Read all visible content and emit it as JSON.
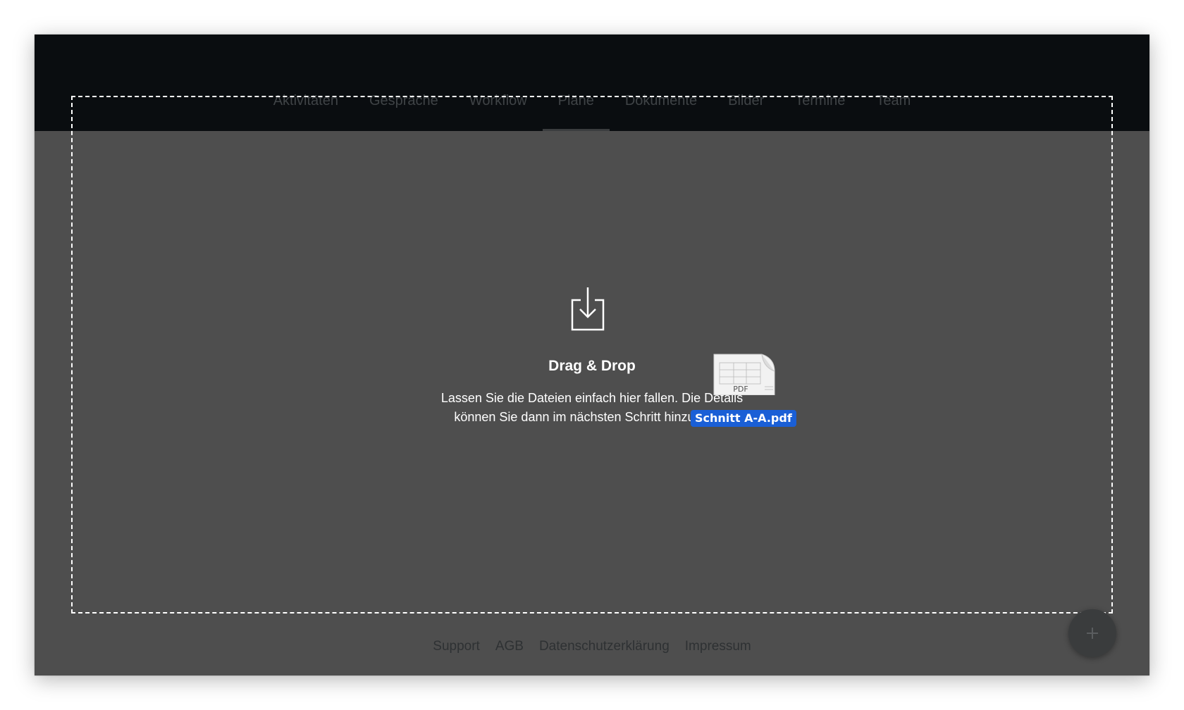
{
  "nav": {
    "tabs": [
      {
        "label": "Aktivitäten"
      },
      {
        "label": "Gespräche"
      },
      {
        "label": "Workflow"
      },
      {
        "label": "Pläne",
        "active": true
      },
      {
        "label": "Dokumente"
      },
      {
        "label": "Bilder"
      },
      {
        "label": "Termine"
      },
      {
        "label": "Team"
      }
    ]
  },
  "dropzone": {
    "title": "Drag & Drop",
    "description": "Lassen Sie die Dateien einfach hier fallen. Die Details können Sie dann im nächsten Schritt hinzufügen.",
    "icon": "download-tray-icon"
  },
  "drag_file": {
    "type_label": "PDF",
    "file_name": "Schnitt A-A.pdf",
    "icon": "pdf-file-icon"
  },
  "footer": {
    "links": [
      {
        "label": "Support"
      },
      {
        "label": "AGB"
      },
      {
        "label": "Datenschutzerklärung"
      },
      {
        "label": "Impressum"
      }
    ]
  },
  "fab": {
    "icon": "plus-icon"
  },
  "colors": {
    "topbar": "#0a0d10",
    "overlay": "#4e4e4e",
    "drag_label_bg": "#1a5fd6"
  }
}
